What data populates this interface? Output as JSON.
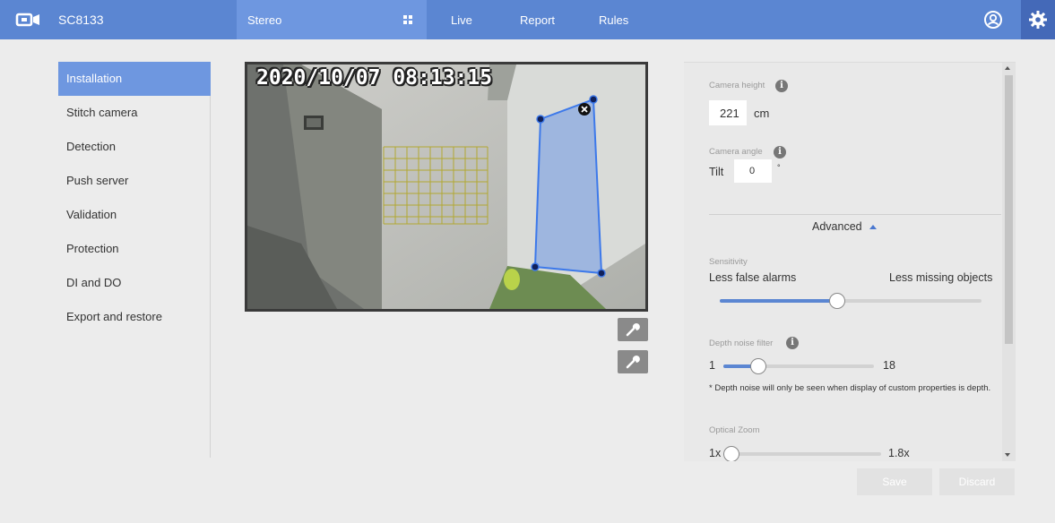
{
  "header": {
    "model": "SC8133",
    "mode_label": "Stereo",
    "nav": [
      "Live",
      "Report",
      "Rules"
    ],
    "icons": [
      "vivotek-logo-icon",
      "grid-icon",
      "user-icon",
      "gear-icon"
    ],
    "accent_color": "#5b86d2"
  },
  "sidebar": {
    "items": [
      {
        "label": "Installation",
        "active": true
      },
      {
        "label": "Stitch camera",
        "active": false
      },
      {
        "label": "Detection",
        "active": false
      },
      {
        "label": "Push server",
        "active": false
      },
      {
        "label": "Validation",
        "active": false
      },
      {
        "label": "Protection",
        "active": false
      },
      {
        "label": "DI and DO",
        "active": false
      },
      {
        "label": "Export and restore",
        "active": false
      }
    ]
  },
  "video": {
    "timestamp": "2020/10/07 08:13:15"
  },
  "settings": {
    "camera_height": {
      "label": "Camera height",
      "value": "221",
      "unit": "cm"
    },
    "camera_angle": {
      "label": "Camera angle",
      "tilt_label": "Tilt",
      "tilt_value": "0",
      "tilt_unit": "°"
    },
    "advanced_label": "Advanced",
    "sensitivity": {
      "label": "Sensitivity",
      "left": "Less false alarms",
      "right": "Less missing objects",
      "level": 0.45
    },
    "depth_noise_filter": {
      "label": "Depth noise filter",
      "min": "1",
      "max": "18",
      "level": 0.23
    },
    "depth_note": "* Depth noise will only be seen when display of custom properties is depth.",
    "optical_zoom": {
      "label": "Optical Zoom",
      "min": "1x",
      "max": "1.8x",
      "level": 0.05
    }
  },
  "buttons": {
    "save": "Save",
    "discard": "Discard"
  }
}
